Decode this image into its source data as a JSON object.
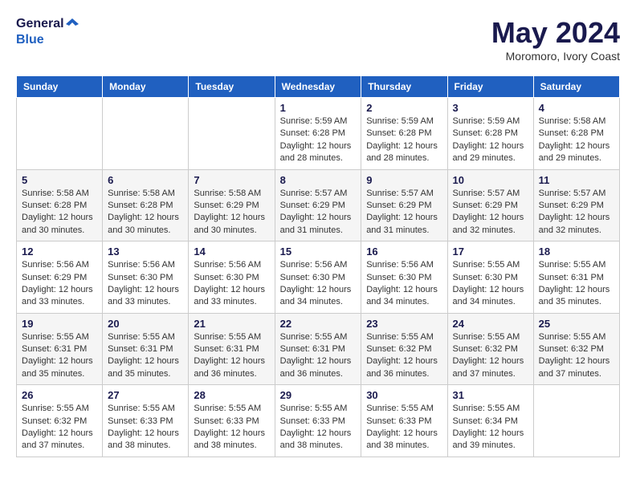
{
  "header": {
    "logo_line1": "General",
    "logo_line2": "Blue",
    "month": "May 2024",
    "location": "Moromoro, Ivory Coast"
  },
  "days_of_week": [
    "Sunday",
    "Monday",
    "Tuesday",
    "Wednesday",
    "Thursday",
    "Friday",
    "Saturday"
  ],
  "weeks": [
    [
      {
        "day": "",
        "info": ""
      },
      {
        "day": "",
        "info": ""
      },
      {
        "day": "",
        "info": ""
      },
      {
        "day": "1",
        "info": "Sunrise: 5:59 AM\nSunset: 6:28 PM\nDaylight: 12 hours\nand 28 minutes."
      },
      {
        "day": "2",
        "info": "Sunrise: 5:59 AM\nSunset: 6:28 PM\nDaylight: 12 hours\nand 28 minutes."
      },
      {
        "day": "3",
        "info": "Sunrise: 5:59 AM\nSunset: 6:28 PM\nDaylight: 12 hours\nand 29 minutes."
      },
      {
        "day": "4",
        "info": "Sunrise: 5:58 AM\nSunset: 6:28 PM\nDaylight: 12 hours\nand 29 minutes."
      }
    ],
    [
      {
        "day": "5",
        "info": "Sunrise: 5:58 AM\nSunset: 6:28 PM\nDaylight: 12 hours\nand 30 minutes."
      },
      {
        "day": "6",
        "info": "Sunrise: 5:58 AM\nSunset: 6:28 PM\nDaylight: 12 hours\nand 30 minutes."
      },
      {
        "day": "7",
        "info": "Sunrise: 5:58 AM\nSunset: 6:29 PM\nDaylight: 12 hours\nand 30 minutes."
      },
      {
        "day": "8",
        "info": "Sunrise: 5:57 AM\nSunset: 6:29 PM\nDaylight: 12 hours\nand 31 minutes."
      },
      {
        "day": "9",
        "info": "Sunrise: 5:57 AM\nSunset: 6:29 PM\nDaylight: 12 hours\nand 31 minutes."
      },
      {
        "day": "10",
        "info": "Sunrise: 5:57 AM\nSunset: 6:29 PM\nDaylight: 12 hours\nand 32 minutes."
      },
      {
        "day": "11",
        "info": "Sunrise: 5:57 AM\nSunset: 6:29 PM\nDaylight: 12 hours\nand 32 minutes."
      }
    ],
    [
      {
        "day": "12",
        "info": "Sunrise: 5:56 AM\nSunset: 6:29 PM\nDaylight: 12 hours\nand 33 minutes."
      },
      {
        "day": "13",
        "info": "Sunrise: 5:56 AM\nSunset: 6:30 PM\nDaylight: 12 hours\nand 33 minutes."
      },
      {
        "day": "14",
        "info": "Sunrise: 5:56 AM\nSunset: 6:30 PM\nDaylight: 12 hours\nand 33 minutes."
      },
      {
        "day": "15",
        "info": "Sunrise: 5:56 AM\nSunset: 6:30 PM\nDaylight: 12 hours\nand 34 minutes."
      },
      {
        "day": "16",
        "info": "Sunrise: 5:56 AM\nSunset: 6:30 PM\nDaylight: 12 hours\nand 34 minutes."
      },
      {
        "day": "17",
        "info": "Sunrise: 5:55 AM\nSunset: 6:30 PM\nDaylight: 12 hours\nand 34 minutes."
      },
      {
        "day": "18",
        "info": "Sunrise: 5:55 AM\nSunset: 6:31 PM\nDaylight: 12 hours\nand 35 minutes."
      }
    ],
    [
      {
        "day": "19",
        "info": "Sunrise: 5:55 AM\nSunset: 6:31 PM\nDaylight: 12 hours\nand 35 minutes."
      },
      {
        "day": "20",
        "info": "Sunrise: 5:55 AM\nSunset: 6:31 PM\nDaylight: 12 hours\nand 35 minutes."
      },
      {
        "day": "21",
        "info": "Sunrise: 5:55 AM\nSunset: 6:31 PM\nDaylight: 12 hours\nand 36 minutes."
      },
      {
        "day": "22",
        "info": "Sunrise: 5:55 AM\nSunset: 6:31 PM\nDaylight: 12 hours\nand 36 minutes."
      },
      {
        "day": "23",
        "info": "Sunrise: 5:55 AM\nSunset: 6:32 PM\nDaylight: 12 hours\nand 36 minutes."
      },
      {
        "day": "24",
        "info": "Sunrise: 5:55 AM\nSunset: 6:32 PM\nDaylight: 12 hours\nand 37 minutes."
      },
      {
        "day": "25",
        "info": "Sunrise: 5:55 AM\nSunset: 6:32 PM\nDaylight: 12 hours\nand 37 minutes."
      }
    ],
    [
      {
        "day": "26",
        "info": "Sunrise: 5:55 AM\nSunset: 6:32 PM\nDaylight: 12 hours\nand 37 minutes."
      },
      {
        "day": "27",
        "info": "Sunrise: 5:55 AM\nSunset: 6:33 PM\nDaylight: 12 hours\nand 38 minutes."
      },
      {
        "day": "28",
        "info": "Sunrise: 5:55 AM\nSunset: 6:33 PM\nDaylight: 12 hours\nand 38 minutes."
      },
      {
        "day": "29",
        "info": "Sunrise: 5:55 AM\nSunset: 6:33 PM\nDaylight: 12 hours\nand 38 minutes."
      },
      {
        "day": "30",
        "info": "Sunrise: 5:55 AM\nSunset: 6:33 PM\nDaylight: 12 hours\nand 38 minutes."
      },
      {
        "day": "31",
        "info": "Sunrise: 5:55 AM\nSunset: 6:34 PM\nDaylight: 12 hours\nand 39 minutes."
      },
      {
        "day": "",
        "info": ""
      }
    ]
  ]
}
